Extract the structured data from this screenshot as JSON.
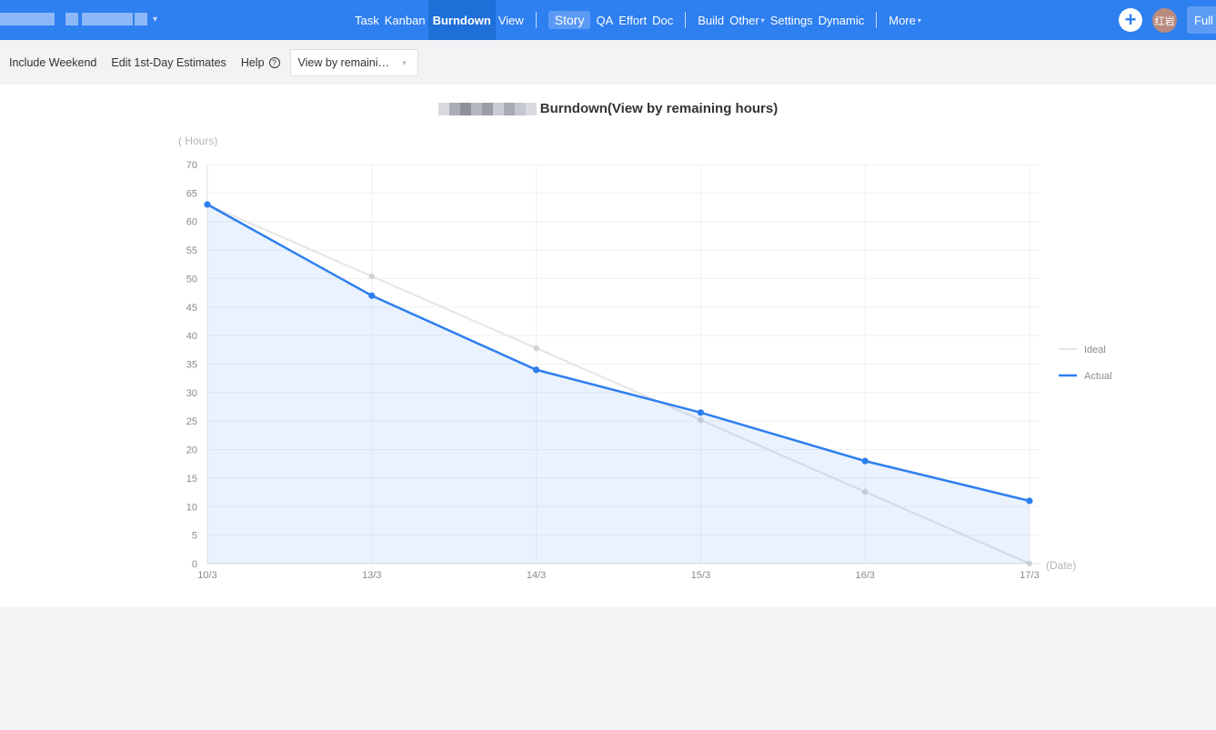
{
  "nav": {
    "items": [
      {
        "label": "Task"
      },
      {
        "label": "Kanban"
      },
      {
        "label": "Burndown",
        "active": true
      },
      {
        "label": "View"
      },
      {
        "sep": true
      },
      {
        "label": "Story",
        "pill": true
      },
      {
        "label": "QA"
      },
      {
        "label": "Effort"
      },
      {
        "label": "Doc"
      },
      {
        "sep": true
      },
      {
        "label": "Build"
      },
      {
        "label": "Other",
        "dropdown": true
      },
      {
        "label": "Settings"
      },
      {
        "label": "Dynamic"
      },
      {
        "sep": true
      },
      {
        "label": "More",
        "dropdown": true
      }
    ],
    "avatar_text": "红岩",
    "full_label": "Full",
    "plus_icon": "plus-circle-icon"
  },
  "toolbar": {
    "include_weekend": "Include Weekend",
    "edit_estimates": "Edit 1st-Day Estimates",
    "help": "Help",
    "help_icon": "?",
    "select_value": "View by remaini…"
  },
  "chart_data": {
    "type": "line",
    "title": "Burndown(View by remaining hours)",
    "ylabel": "( Hours)",
    "xlabel": "(Date)",
    "categories": [
      "10/3",
      "13/3",
      "14/3",
      "15/3",
      "16/3",
      "17/3"
    ],
    "ylim": [
      0,
      70
    ],
    "yticks": [
      0,
      5,
      10,
      15,
      20,
      25,
      30,
      35,
      40,
      45,
      50,
      55,
      60,
      65,
      70
    ],
    "grid": true,
    "legend_position": "right",
    "series": [
      {
        "name": "Ideal",
        "values": [
          63,
          50.4,
          37.8,
          25.2,
          12.6,
          0
        ],
        "color": "#e6e6e6"
      },
      {
        "name": "Actual",
        "values": [
          63,
          47,
          34,
          26.5,
          18,
          11
        ],
        "color": "#2e7ff0",
        "area": true
      }
    ]
  }
}
